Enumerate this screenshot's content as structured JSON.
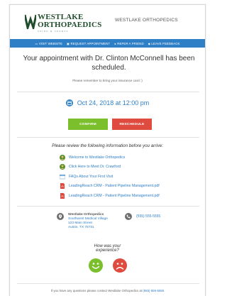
{
  "header": {
    "logo": {
      "line1": "WESTLAKE",
      "line2": "ORTHOPAEDICS",
      "tagline": "SPINE & SPORTS"
    },
    "brand_name": "WESTLAKE ORTHOPEDICS"
  },
  "nav": {
    "items": [
      {
        "label": "VISIT WEBSITE",
        "icon": "monitor-icon"
      },
      {
        "label": "REQUEST APPOINTMENT",
        "icon": "calendar-icon"
      },
      {
        "label": "REFER A FRIEND",
        "icon": "user-icon"
      },
      {
        "label": "LEAVE FEEDBACK",
        "icon": "comment-icon"
      }
    ],
    "color": "#2f7fc6"
  },
  "headline": "Your appointment with Dr. Clinton McConnell has been scheduled.",
  "note": "Please remember to bring your insurance card :)",
  "appointment": {
    "datetime": "Oct 24, 2018 at 12:00 pm"
  },
  "actions": {
    "confirm_label": "CONFIRM",
    "reschedule_label": "RESCHEDULE",
    "confirm_color": "#7bbf2c",
    "reschedule_color": "#e04b3f"
  },
  "review": {
    "title": "Please review the following information before you arrive:",
    "links": [
      {
        "label": "Welcome to Westlake Orthopedics",
        "icon": "video-icon"
      },
      {
        "label": "Click Here to Meet Dr. Crawford",
        "icon": "video-icon"
      },
      {
        "label": "FAQs About Your First Visit",
        "icon": "document-icon"
      },
      {
        "label": "LeadingReach CRM - Patient Pipeline Management.pdf",
        "icon": "pdf-icon"
      },
      {
        "label": "LeadingReach CRM - Patient Pipeline Management.pdf",
        "icon": "pdf-icon"
      }
    ]
  },
  "contact": {
    "name": "Westlake Orthopedics",
    "address_line1": "Southwest Medical Village",
    "address_line2": "123 Main Street",
    "address_line3": "Austin, TX 78731",
    "phone": "(555) 555-5555"
  },
  "feedback": {
    "line1": "How was your",
    "line2": "experience?",
    "positive_color": "#7bbf2c",
    "negative_color": "#e04b3f"
  },
  "footer": {
    "text": "If you have any questions please contact Westlake Orthopedics at",
    "phone": "(555) 555-5555"
  }
}
